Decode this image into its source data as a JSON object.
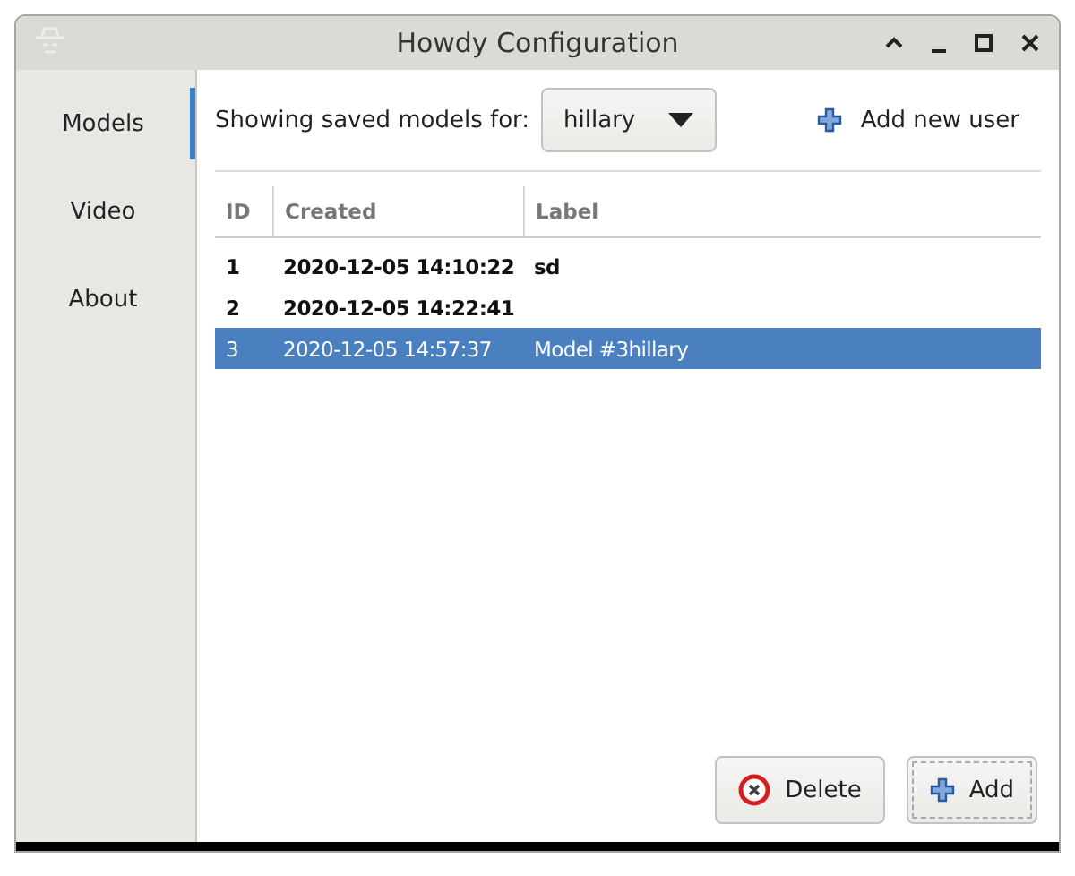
{
  "window": {
    "title": "Howdy Configuration"
  },
  "sidebar": {
    "items": [
      {
        "label": "Models",
        "selected": true
      },
      {
        "label": "Video",
        "selected": false
      },
      {
        "label": "About",
        "selected": false
      }
    ]
  },
  "toolbar": {
    "label": "Showing saved models for:",
    "user_select": {
      "value": "hillary"
    },
    "add_user": "Add new user"
  },
  "table": {
    "columns": [
      "ID",
      "Created",
      "Label"
    ],
    "rows": [
      {
        "cells": [
          "1",
          "2020-12-05 14:10:22",
          "sd"
        ],
        "selected": false
      },
      {
        "cells": [
          "2",
          "2020-12-05 14:22:41",
          ""
        ],
        "selected": false
      },
      {
        "cells": [
          "3",
          "2020-12-05 14:57:37",
          "Model #3hillary"
        ],
        "selected": true
      }
    ]
  },
  "buttons": [
    {
      "kind": "delete",
      "label": "Delete"
    },
    {
      "kind": "add",
      "label": "Add"
    }
  ]
}
